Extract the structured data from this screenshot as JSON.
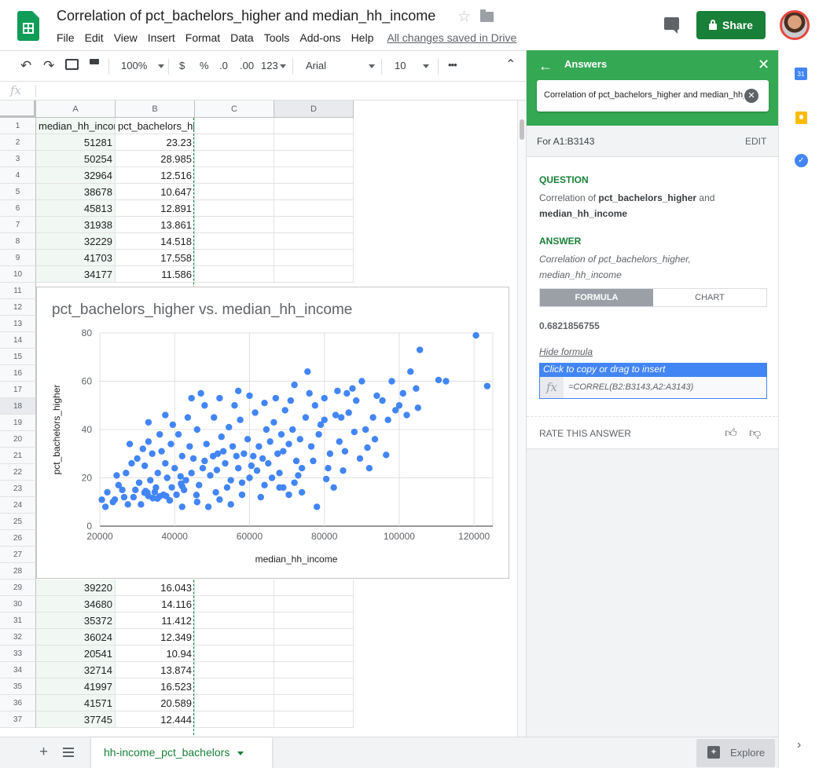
{
  "header": {
    "doc_title": "Correlation of pct_bachelors_higher and median_hh_income",
    "menu": [
      "File",
      "Edit",
      "View",
      "Insert",
      "Format",
      "Data",
      "Tools",
      "Add-ons",
      "Help"
    ],
    "saved_status": "All changes saved in Drive",
    "share_label": "Share"
  },
  "toolbar": {
    "zoom": "100%",
    "currency": "$",
    "percent": "%",
    "dec_decrease": ".0",
    "dec_increase": ".00",
    "more_formats": "123",
    "font": "Arial",
    "font_size": "10",
    "more": "•••"
  },
  "formula_bar": {
    "icon": "fx"
  },
  "grid": {
    "columns": [
      "A",
      "B",
      "C",
      "D"
    ],
    "header_row": {
      "row": "1",
      "a": "median_hh_income",
      "b": "pct_bachelors_higher"
    },
    "top_rows": [
      {
        "row": "2",
        "a": "51281",
        "b": "23.23"
      },
      {
        "row": "3",
        "a": "50254",
        "b": "28.985"
      },
      {
        "row": "4",
        "a": "32964",
        "b": "12.516"
      },
      {
        "row": "5",
        "a": "38678",
        "b": "10.647"
      },
      {
        "row": "6",
        "a": "45813",
        "b": "12.891"
      },
      {
        "row": "7",
        "a": "31938",
        "b": "13.861"
      },
      {
        "row": "8",
        "a": "32229",
        "b": "14.518"
      },
      {
        "row": "9",
        "a": "41703",
        "b": "17.558"
      },
      {
        "row": "10",
        "a": "34177",
        "b": "11.586"
      }
    ],
    "hidden_row_numbers": [
      "11",
      "12",
      "13",
      "14",
      "15",
      "16",
      "17",
      "18",
      "19",
      "20",
      "21",
      "22",
      "23",
      "24",
      "25",
      "26",
      "27",
      "28"
    ],
    "bottom_rows": [
      {
        "row": "29",
        "a": "39220",
        "b": "16.043"
      },
      {
        "row": "30",
        "a": "34680",
        "b": "14.116"
      },
      {
        "row": "31",
        "a": "35372",
        "b": "11.412"
      },
      {
        "row": "32",
        "a": "36024",
        "b": "12.349"
      },
      {
        "row": "33",
        "a": "20541",
        "b": "10.94"
      },
      {
        "row": "34",
        "a": "32714",
        "b": "13.874"
      },
      {
        "row": "35",
        "a": "41997",
        "b": "16.523"
      },
      {
        "row": "36",
        "a": "41571",
        "b": "20.589"
      },
      {
        "row": "37",
        "a": "37745",
        "b": "12.444"
      }
    ]
  },
  "chart_data": {
    "type": "scatter",
    "title": "pct_bachelors_higher vs. median_hh_income",
    "xlabel": "median_hh_income",
    "ylabel": "pct_bachelors_higher",
    "xlim": [
      20000,
      125000
    ],
    "ylim": [
      0,
      80
    ],
    "xticks": [
      "20000",
      "40000",
      "60000",
      "80000",
      "100000",
      "120000"
    ],
    "yticks": [
      "0",
      "20",
      "40",
      "60",
      "80"
    ],
    "grid": true,
    "color": "#4285f4",
    "points": [
      [
        51281,
        23.23
      ],
      [
        50254,
        28.985
      ],
      [
        32964,
        12.516
      ],
      [
        38678,
        10.647
      ],
      [
        45813,
        12.891
      ],
      [
        31938,
        13.861
      ],
      [
        32229,
        14.518
      ],
      [
        41703,
        17.558
      ],
      [
        34177,
        11.586
      ],
      [
        39220,
        16.043
      ],
      [
        34680,
        14.116
      ],
      [
        35372,
        11.412
      ],
      [
        36024,
        12.349
      ],
      [
        20541,
        10.94
      ],
      [
        32714,
        13.874
      ],
      [
        41997,
        16.523
      ],
      [
        41571,
        20.589
      ],
      [
        37745,
        12.444
      ],
      [
        120500,
        79
      ],
      [
        105500,
        73
      ],
      [
        123500,
        58
      ],
      [
        110500,
        60.5
      ],
      [
        112500,
        60
      ],
      [
        103000,
        64
      ],
      [
        104500,
        57
      ],
      [
        98000,
        60
      ],
      [
        101000,
        55
      ],
      [
        105000,
        49
      ],
      [
        95500,
        52
      ],
      [
        90000,
        60
      ],
      [
        86000,
        55
      ],
      [
        84500,
        45
      ],
      [
        79000,
        42
      ],
      [
        99000,
        48
      ],
      [
        93000,
        45
      ],
      [
        88000,
        39
      ],
      [
        96500,
        29.5
      ],
      [
        91500,
        32.5
      ],
      [
        80500,
        19.5
      ],
      [
        85000,
        23
      ],
      [
        92000,
        24
      ],
      [
        78000,
        8
      ],
      [
        82500,
        16
      ],
      [
        74000,
        14
      ],
      [
        69000,
        16
      ],
      [
        70500,
        13
      ],
      [
        66000,
        20
      ],
      [
        62000,
        23
      ],
      [
        58000,
        18
      ],
      [
        54000,
        16
      ],
      [
        74000,
        24
      ],
      [
        72000,
        58.5
      ],
      [
        75500,
        64
      ],
      [
        57000,
        56
      ],
      [
        47000,
        55
      ],
      [
        44500,
        53
      ],
      [
        37500,
        46
      ],
      [
        33000,
        43
      ],
      [
        28000,
        34
      ],
      [
        25000,
        17
      ],
      [
        22000,
        14
      ],
      [
        21500,
        8
      ],
      [
        23500,
        10
      ],
      [
        26500,
        12
      ],
      [
        29500,
        15
      ],
      [
        31000,
        9
      ],
      [
        33500,
        19
      ],
      [
        35500,
        22
      ],
      [
        36500,
        31
      ],
      [
        37500,
        26
      ],
      [
        39000,
        34
      ],
      [
        40000,
        24
      ],
      [
        41000,
        38
      ],
      [
        42000,
        29
      ],
      [
        43000,
        19
      ],
      [
        44000,
        33
      ],
      [
        45000,
        28
      ],
      [
        46000,
        40
      ],
      [
        47500,
        24
      ],
      [
        48500,
        34
      ],
      [
        49500,
        21
      ],
      [
        50500,
        45
      ],
      [
        51500,
        30
      ],
      [
        52500,
        37
      ],
      [
        53500,
        26
      ],
      [
        54500,
        41
      ],
      [
        55500,
        33
      ],
      [
        56500,
        29
      ],
      [
        57500,
        44
      ],
      [
        58500,
        30
      ],
      [
        59500,
        36
      ],
      [
        60500,
        25
      ],
      [
        61500,
        47
      ],
      [
        62500,
        33
      ],
      [
        63500,
        28
      ],
      [
        64500,
        40
      ],
      [
        65500,
        35
      ],
      [
        66500,
        43
      ],
      [
        67500,
        30
      ],
      [
        68500,
        38
      ],
      [
        69500,
        48
      ],
      [
        70500,
        34
      ],
      [
        71500,
        40
      ],
      [
        72500,
        27
      ],
      [
        73500,
        36
      ],
      [
        75000,
        45
      ],
      [
        76500,
        33
      ],
      [
        77500,
        50
      ],
      [
        78500,
        38
      ],
      [
        80000,
        44
      ],
      [
        81500,
        30
      ],
      [
        83000,
        46
      ],
      [
        84000,
        35
      ],
      [
        86500,
        47
      ],
      [
        88500,
        52
      ],
      [
        91000,
        40
      ],
      [
        94000,
        54
      ],
      [
        97000,
        44
      ],
      [
        100000,
        50
      ],
      [
        102000,
        46
      ],
      [
        27000,
        22
      ],
      [
        30000,
        28
      ],
      [
        32000,
        25
      ],
      [
        34000,
        30
      ],
      [
        38000,
        20
      ],
      [
        42500,
        15
      ],
      [
        46500,
        17
      ],
      [
        51000,
        14
      ],
      [
        55000,
        19
      ],
      [
        60000,
        20
      ],
      [
        64000,
        17
      ],
      [
        68000,
        22
      ],
      [
        30500,
        18
      ],
      [
        29000,
        12
      ],
      [
        27500,
        9
      ],
      [
        26000,
        15
      ],
      [
        24000,
        11
      ],
      [
        35000,
        16
      ],
      [
        40500,
        13
      ],
      [
        44500,
        22
      ],
      [
        48000,
        27
      ],
      [
        53000,
        31
      ],
      [
        57000,
        24
      ],
      [
        61000,
        29
      ],
      [
        65000,
        26
      ],
      [
        69000,
        31
      ],
      [
        73000,
        21
      ],
      [
        77000,
        27
      ],
      [
        81000,
        24
      ],
      [
        85500,
        31
      ],
      [
        89500,
        28
      ],
      [
        93500,
        36
      ],
      [
        36000,
        38
      ],
      [
        39500,
        42
      ],
      [
        43500,
        45
      ],
      [
        48000,
        50
      ],
      [
        52000,
        53
      ],
      [
        56000,
        50
      ],
      [
        60000,
        54
      ],
      [
        64000,
        51
      ],
      [
        67000,
        53
      ],
      [
        71000,
        52
      ],
      [
        76000,
        55
      ],
      [
        80000,
        53
      ],
      [
        83500,
        56
      ],
      [
        87500,
        57
      ],
      [
        33000,
        35
      ],
      [
        28500,
        26
      ],
      [
        24500,
        21
      ],
      [
        31500,
        32
      ],
      [
        37000,
        13
      ],
      [
        46000,
        10
      ],
      [
        52000,
        11
      ],
      [
        58000,
        13
      ],
      [
        63000,
        12
      ],
      [
        68000,
        16
      ],
      [
        72000,
        18
      ],
      [
        42000,
        8
      ],
      [
        49000,
        8
      ],
      [
        55000,
        9
      ]
    ]
  },
  "answers_panel": {
    "title": "Answers",
    "query": "Correlation of pct_bachelors_higher and median_hh_income",
    "range_label": "For A1:B3143",
    "edit_label": "EDIT",
    "question_head": "QUESTION",
    "question_prefix": "Correlation of ",
    "question_var1": "pct_bachelors_higher",
    "question_and": " and",
    "question_var2": "median_hh_income",
    "answer_head": "ANSWER",
    "answer_text": "Correlation of pct_bachelors_higher, median_hh_income",
    "tab_formula": "FORMULA",
    "tab_chart": "CHART",
    "correlation_value": "0.6821856755",
    "hide_formula": "Hide formula",
    "insert_hint": "Click to copy or drag to insert",
    "formula": "=CORREL(B2:B3143,A2:A3143)",
    "rate_label": "RATE THIS ANSWER"
  },
  "rail": {
    "calendar_day": "31"
  },
  "bottom": {
    "sheet_tab": "hh-income_pct_bachelors",
    "explore_label": "Explore"
  }
}
